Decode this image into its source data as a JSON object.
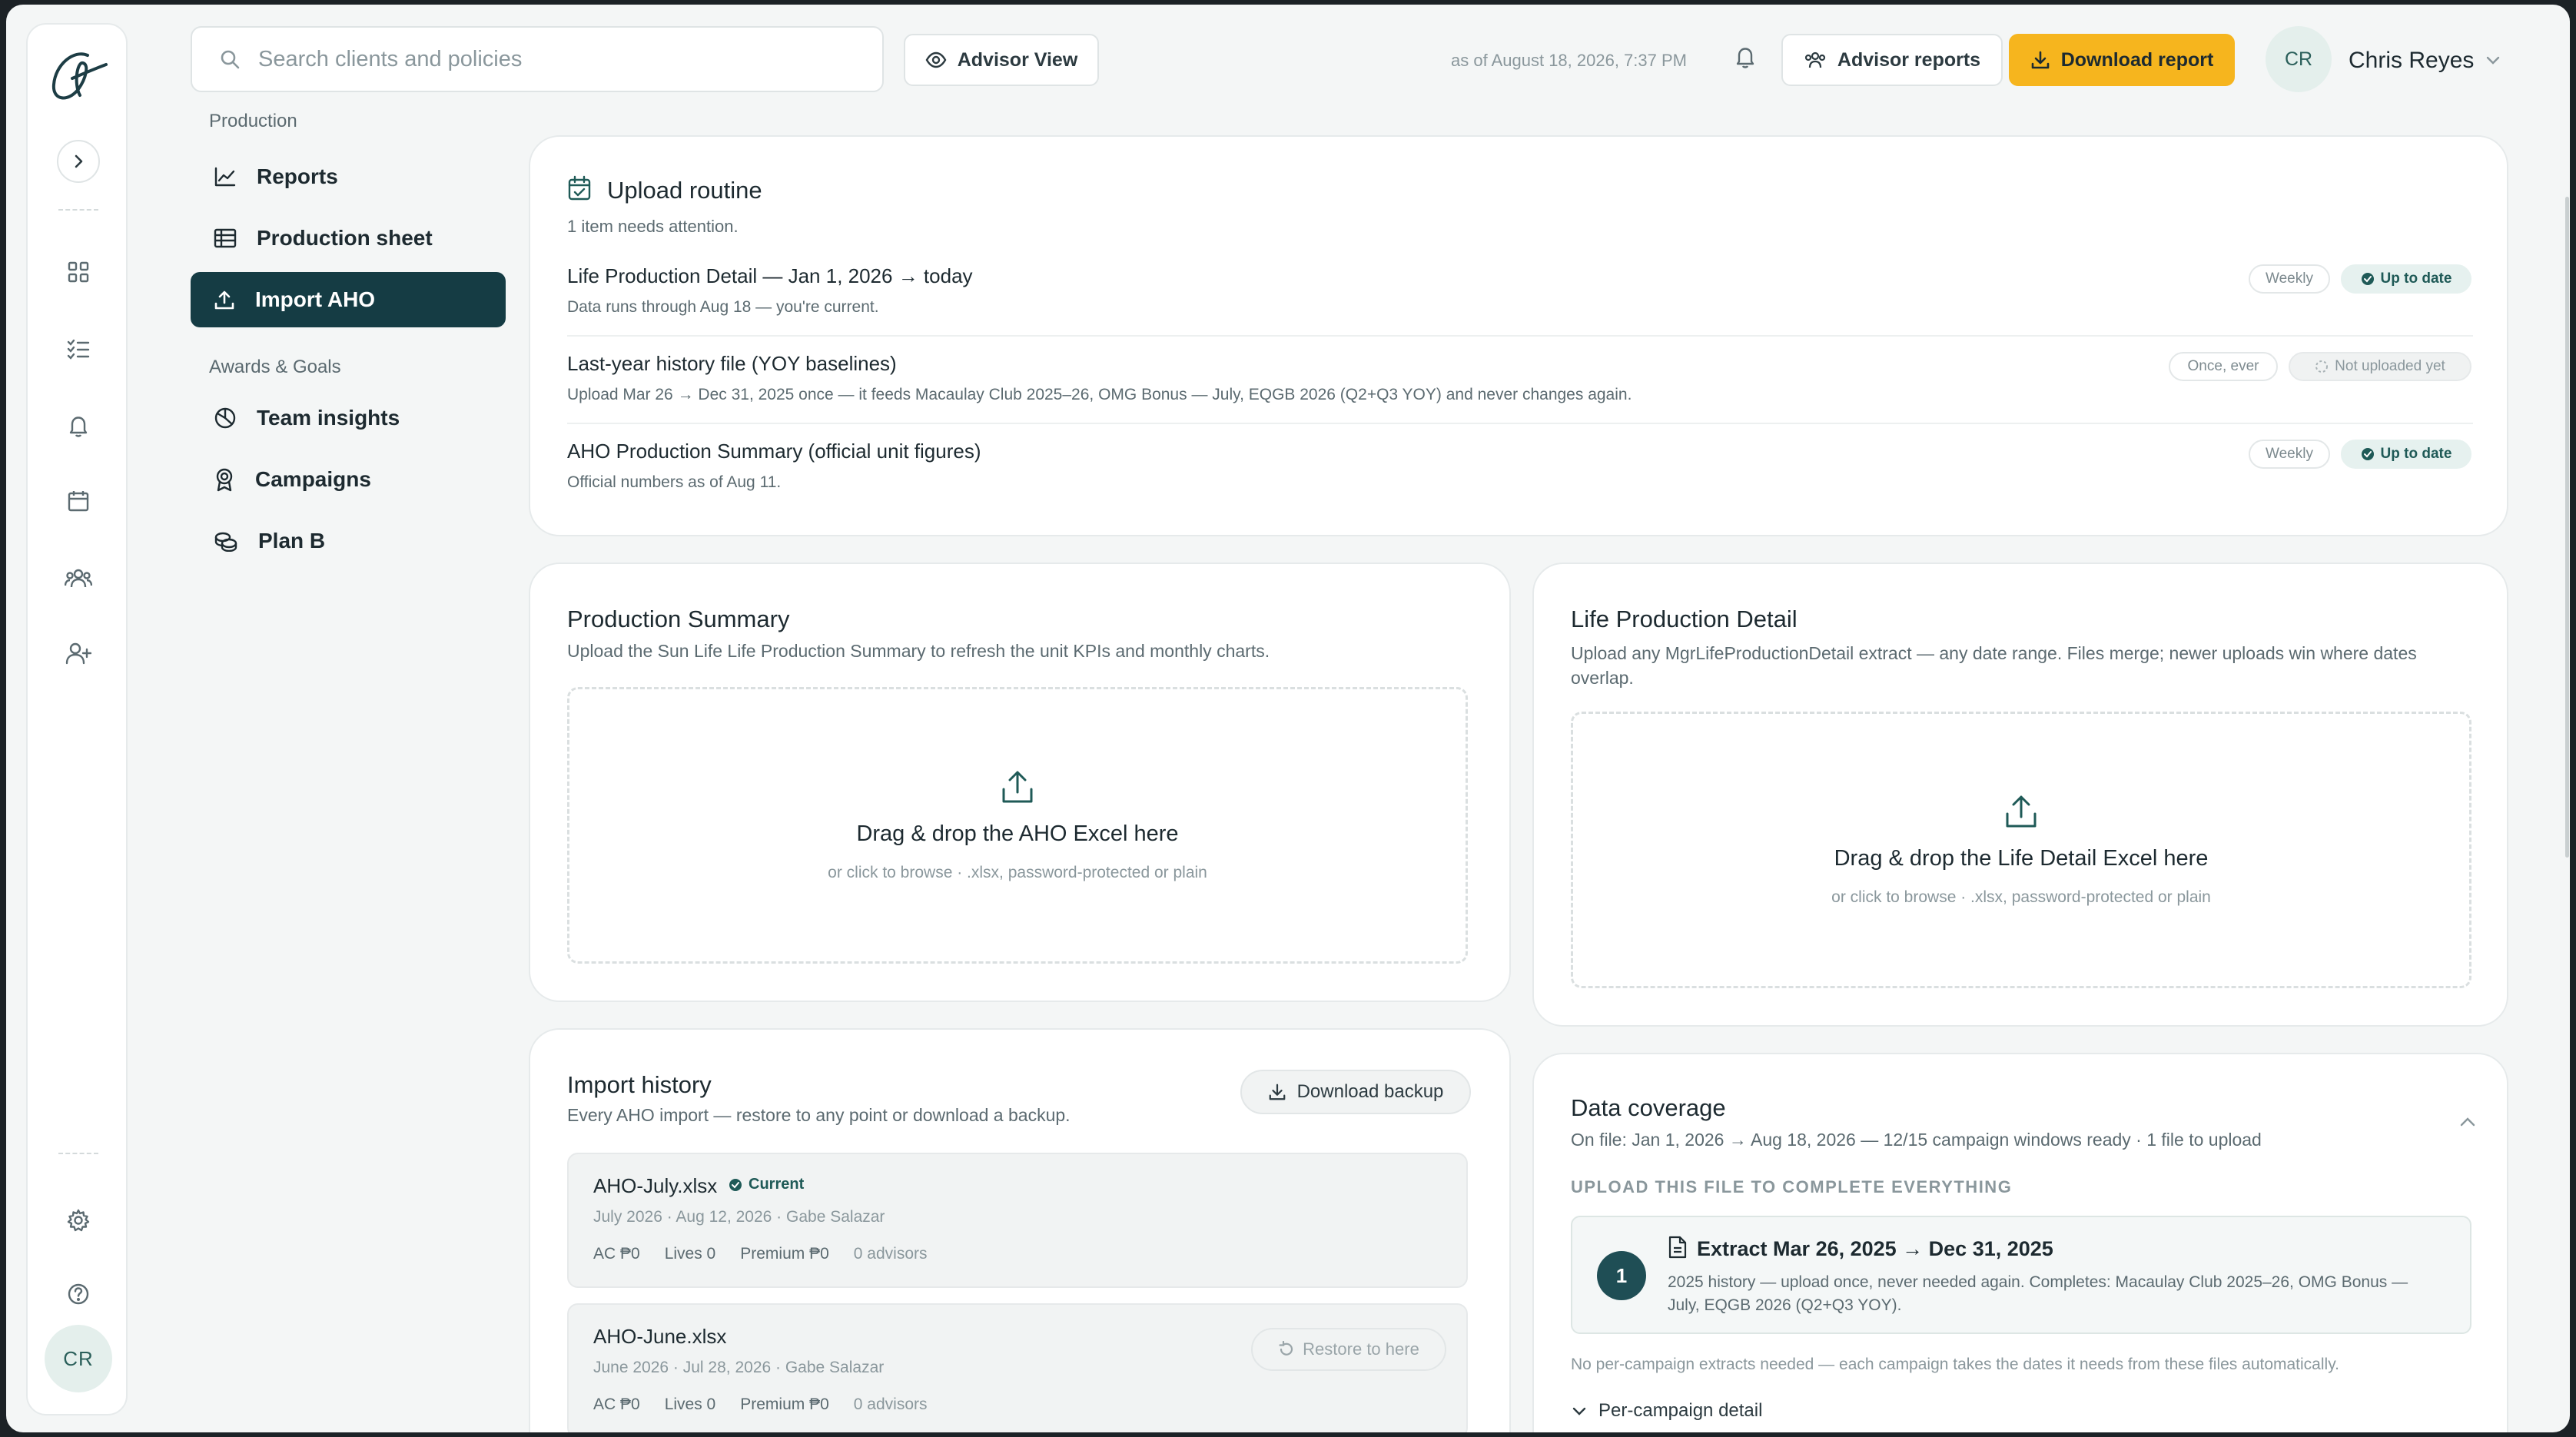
{
  "topbar": {
    "search_placeholder": "Search clients and policies",
    "advisor_view": "Advisor View",
    "as_of": "as of August 18, 2026, 7:37 PM",
    "advisor_reports": "Advisor reports",
    "download_report": "Download report",
    "user_initials": "CR",
    "user_name": "Chris Reyes"
  },
  "rail": {
    "avatar_initials": "CR"
  },
  "nav": {
    "section_production": "Production",
    "reports": "Reports",
    "production_sheet": "Production sheet",
    "import_aho": "Import AHO",
    "section_awards": "Awards & Goals",
    "team_insights": "Team insights",
    "campaigns": "Campaigns",
    "plan_b": "Plan B"
  },
  "routine": {
    "title": "Upload routine",
    "subtitle": "1 item needs attention.",
    "items": [
      {
        "title": "Life Production Detail — Jan 1, 2026 → today",
        "sub": "Data runs through Aug 18 — you're current.",
        "freq": "Weekly",
        "status": "Up to date"
      },
      {
        "title": "Last-year history file (YOY baselines)",
        "sub": "Upload Mar 26 → Dec 31, 2025 once — it feeds Macaulay Club 2025–26, OMG Bonus — July, EQGB 2026 (Q2+Q3 YOY) and never changes again.",
        "freq": "Once, ever",
        "status": "Not uploaded yet"
      },
      {
        "title": "AHO Production Summary (official unit figures)",
        "sub": "Official numbers as of Aug 11.",
        "freq": "Weekly",
        "status": "Up to date"
      }
    ]
  },
  "prod_summary": {
    "title": "Production Summary",
    "sub": "Upload the Sun Life Life Production Summary to refresh the unit KPIs and monthly charts.",
    "drop_title": "Drag & drop the AHO Excel here",
    "drop_sub": "or click to browse · .xlsx, password-protected or plain"
  },
  "life_detail": {
    "title": "Life Production Detail",
    "sub": "Upload any MgrLifeProductionDetail extract — any date range. Files merge; newer uploads win where dates overlap.",
    "drop_title": "Drag & drop the Life Detail Excel here",
    "drop_sub": "or click to browse · .xlsx, password-protected or plain"
  },
  "history": {
    "title": "Import history",
    "sub": "Every AHO import — restore to any point or download a backup.",
    "download_backup": "Download backup",
    "items": [
      {
        "file": "AHO-July.xlsx",
        "badge": "Current",
        "meta": "July 2026 · Aug 12, 2026 · Gabe Salazar",
        "ac": "AC ₱0",
        "lives": "Lives 0",
        "premium": "Premium ₱0",
        "advisors": "0 advisors"
      },
      {
        "file": "AHO-June.xlsx",
        "restore": "Restore to here",
        "meta": "June 2026 · Jul 28, 2026 · Gabe Salazar",
        "ac": "AC ₱0",
        "lives": "Lives 0",
        "premium": "Premium ₱0",
        "advisors": "0 advisors"
      }
    ]
  },
  "coverage": {
    "title": "Data coverage",
    "sub": "On file: Jan 1, 2026 → Aug 18, 2026 — 12/15 campaign windows ready · 1 file to upload",
    "section": "UPLOAD THIS FILE TO COMPLETE EVERYTHING",
    "step_num": "1",
    "step_title": "Extract Mar 26, 2025 → Dec 31, 2025",
    "step_desc": "2025 history — upload once, never needed again. Completes: Macaulay Club 2025–26, OMG Bonus — July, EQGB 2026 (Q2+Q3 YOY).",
    "note": "No per-campaign extracts needed — each campaign takes the dates it needs from these files automatically.",
    "detail_toggle": "Per-campaign detail"
  },
  "colors": {
    "accent": "#f6b51e",
    "nav_active": "#153c44",
    "ok": "#1f5a57"
  }
}
